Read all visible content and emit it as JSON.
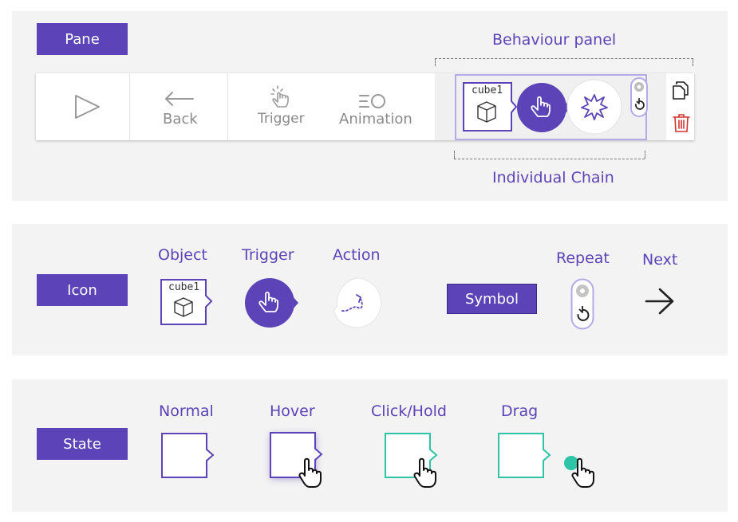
{
  "pane": {
    "tag": "Pane",
    "behaviour_panel_label": "Behaviour panel",
    "individual_chain_label": "Individual Chain",
    "toolbar": {
      "back_label": "Back",
      "trigger_label": "Trigger",
      "animation_label": "Animation"
    },
    "chain": {
      "object_name": "cube1"
    }
  },
  "icon": {
    "tag": "Icon",
    "object_label": "Object",
    "trigger_label": "Trigger",
    "action_label": "Action",
    "symbol_label": "Symbol",
    "repeat_label": "Repeat",
    "next_label": "Next",
    "object_name": "cube1"
  },
  "state": {
    "tag": "State",
    "normal_label": "Normal",
    "hover_label": "Hover",
    "click_label": "Click/Hold",
    "drag_label": "Drag"
  },
  "colors": {
    "accent": "#5c44b8",
    "teal": "#2ec4a6",
    "delete": "#d0312d"
  }
}
